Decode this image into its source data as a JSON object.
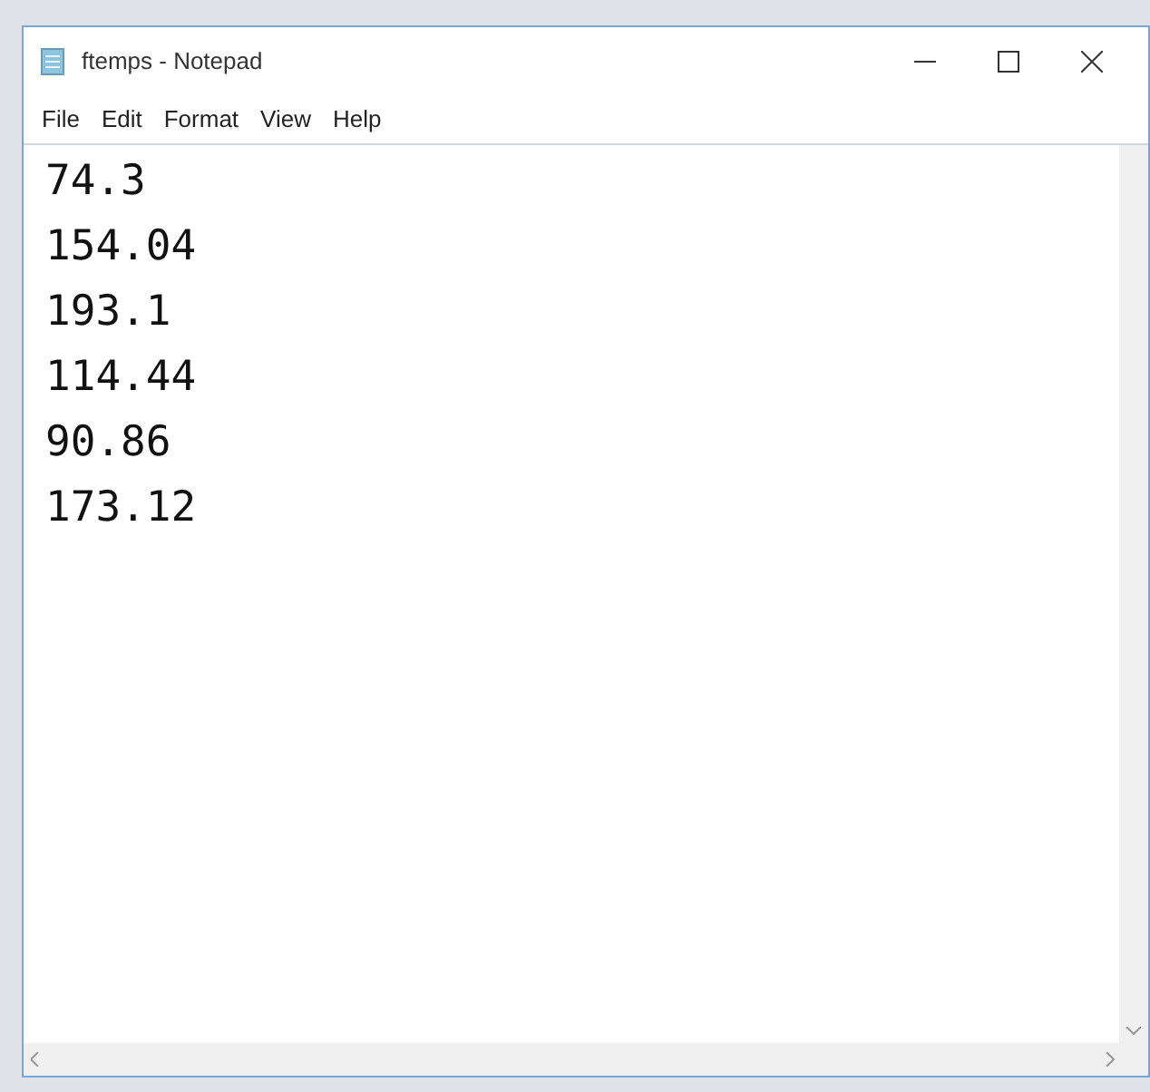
{
  "window": {
    "title": "ftemps - Notepad"
  },
  "menu": [
    "File",
    "Edit",
    "Format",
    "View",
    "Help"
  ],
  "lines": [
    "74.3",
    "154.04",
    "193.1",
    "114.44",
    "90.86",
    "173.12"
  ]
}
